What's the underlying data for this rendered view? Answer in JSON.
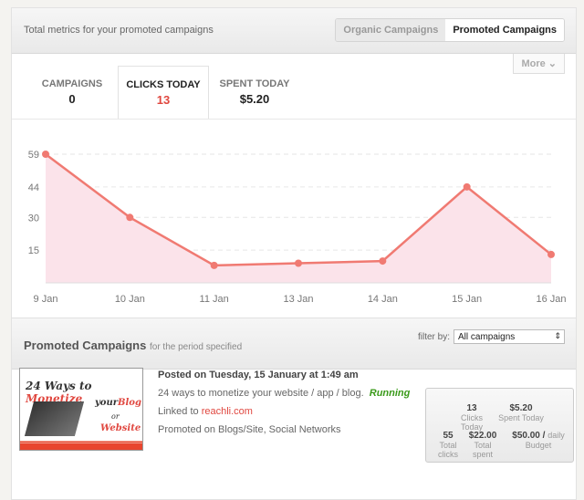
{
  "header": {
    "title": "Total metrics for your promoted campaigns",
    "tabs": [
      "Organic Campaigns",
      "Promoted Campaigns"
    ],
    "more": "More ⌄"
  },
  "metrics": [
    {
      "label": "CAMPAIGNS",
      "value": "0"
    },
    {
      "label": "CLICKS TODAY",
      "value": "13"
    },
    {
      "label": "SPENT TODAY",
      "value": "$5.20"
    }
  ],
  "chart_data": {
    "type": "area",
    "x": [
      "9 Jan",
      "10 Jan",
      "11 Jan",
      "13 Jan",
      "14 Jan",
      "15 Jan",
      "16 Jan"
    ],
    "values": [
      59,
      30,
      8,
      9,
      10,
      44,
      13
    ],
    "yticks": [
      15,
      30,
      44,
      59
    ],
    "ylim": [
      0,
      62
    ],
    "color": "#f07a72",
    "fill": "#fbe3ea"
  },
  "section": {
    "title": "Promoted Campaigns",
    "subtitle": "for the period specified",
    "filter_label": "filter by:",
    "filter_value": "All campaigns"
  },
  "campaign": {
    "thumb": {
      "l1": "24 Ways to",
      "l1b": "Monetize",
      "l2": "your",
      "l2b": "Blog",
      "l3": "or",
      "l4": "Website"
    },
    "posted": "Posted on Tuesday, 15 January at 1:49 am",
    "desc": "24 ways to monetize your website / app / blog.",
    "status": "Running",
    "linked_label": "Linked to",
    "link": "reachli.com",
    "promoted": "Promoted on Blogs/Site, Social Networks",
    "stats": {
      "clicks_today": "13",
      "clicks_today_label": "Clicks Today",
      "spent_today": "$5.20",
      "spent_today_label": "Spent Today",
      "total_clicks": "55",
      "total_clicks_label": "Total clicks",
      "total_spent": "$22.00",
      "total_spent_label": "Total spent",
      "budget": "$50.00 /",
      "budget_unit": "daily",
      "budget_label": "Budget"
    }
  }
}
